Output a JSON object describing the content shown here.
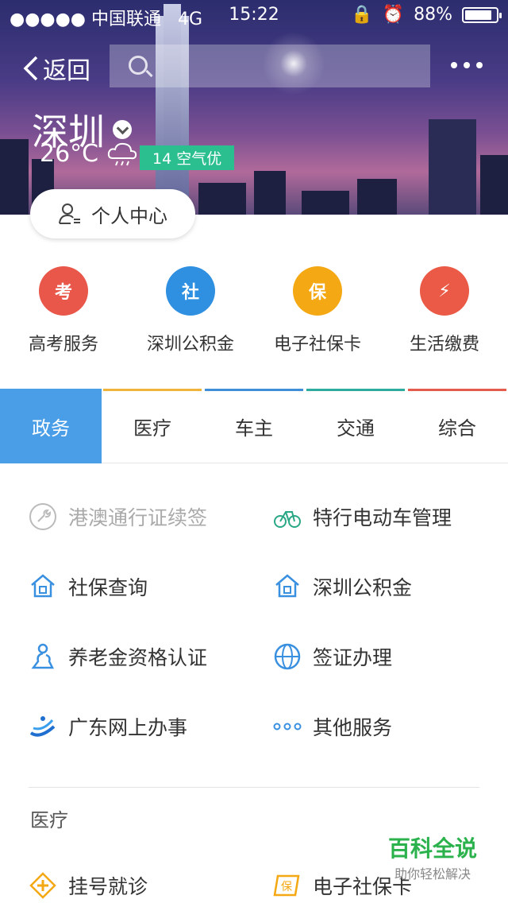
{
  "status_bar": {
    "carrier": "●●●●● 中国联通",
    "network": "4G",
    "time": "15:22",
    "battery": "88%",
    "battery_level": 0.88
  },
  "nav": {
    "back_label": "返回",
    "search_placeholder": ""
  },
  "location": {
    "city": "深圳",
    "temperature": "26°C",
    "aqi": "14 空气优"
  },
  "personal_center": "个人中心",
  "quick_services": [
    {
      "label": "高考服务",
      "glyph": "考",
      "color": "#e9574a"
    },
    {
      "label": "深圳公积金",
      "glyph": "社",
      "color": "#2f8fe0"
    },
    {
      "label": "电子社保卡",
      "glyph": "保",
      "color": "#f4a813"
    },
    {
      "label": "生活缴费",
      "glyph": "⚡",
      "color": "#ea5a46"
    }
  ],
  "tabs": [
    {
      "label": "政务",
      "active": true,
      "color": "#4a9ee8"
    },
    {
      "label": "医疗",
      "active": false,
      "color": "#f0b43a"
    },
    {
      "label": "车主",
      "active": false,
      "color": "#3f8fd8"
    },
    {
      "label": "交通",
      "active": false,
      "color": "#2dab9e"
    },
    {
      "label": "综合",
      "active": false,
      "color": "#e35c4e"
    }
  ],
  "services": [
    {
      "label": "港澳通行证续签",
      "icon": "wrench-icon",
      "disabled": true
    },
    {
      "label": "特行电动车管理",
      "icon": "bicycle-icon",
      "disabled": false
    },
    {
      "label": "社保查询",
      "icon": "home-shield-icon",
      "disabled": false
    },
    {
      "label": "深圳公积金",
      "icon": "home-shield-icon",
      "disabled": false
    },
    {
      "label": "养老金资格认证",
      "icon": "elder-icon",
      "disabled": false
    },
    {
      "label": "签证办理",
      "icon": "globe-icon",
      "disabled": false
    },
    {
      "label": "广东网上办事",
      "icon": "guangdong-logo-icon",
      "disabled": false
    },
    {
      "label": "其他服务",
      "icon": "dots-icon",
      "disabled": false
    }
  ],
  "section_title": "医疗",
  "medical_services": [
    {
      "label": "挂号就诊",
      "icon": "medical-cross-icon"
    },
    {
      "label": "电子社保卡",
      "icon": "social-card-icon"
    }
  ],
  "watermark": {
    "title": "百科全说",
    "subtitle": "助你轻松解决"
  }
}
